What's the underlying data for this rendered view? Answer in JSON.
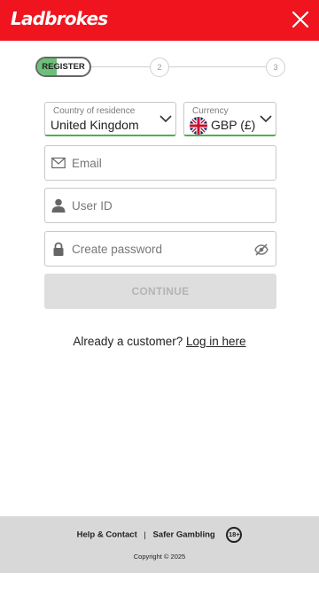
{
  "header": {
    "brand": "Ladbrokes",
    "brand_color": "#f0141e"
  },
  "stepper": {
    "step1_label": "REGISTER",
    "step2": "2",
    "step3": "3",
    "active_color": "#6cc07a"
  },
  "form": {
    "country_label": "Country of residence",
    "country_value": "United Kingdom",
    "currency_label": "Currency",
    "currency_value": "GBP (£)",
    "currency_flag_icon": "uk-flag-icon",
    "email_placeholder": "Email",
    "userid_placeholder": "User ID",
    "password_placeholder": "Create password",
    "continue_label": "CONTINUE",
    "valid_color": "#4caf50"
  },
  "login": {
    "prompt": "Already a customer?",
    "link": "Log in here"
  },
  "footer": {
    "help": "Help & Contact",
    "separator": "|",
    "safer": "Safer Gambling",
    "age_badge": "18+",
    "copyright": "Copyright © 2025"
  }
}
